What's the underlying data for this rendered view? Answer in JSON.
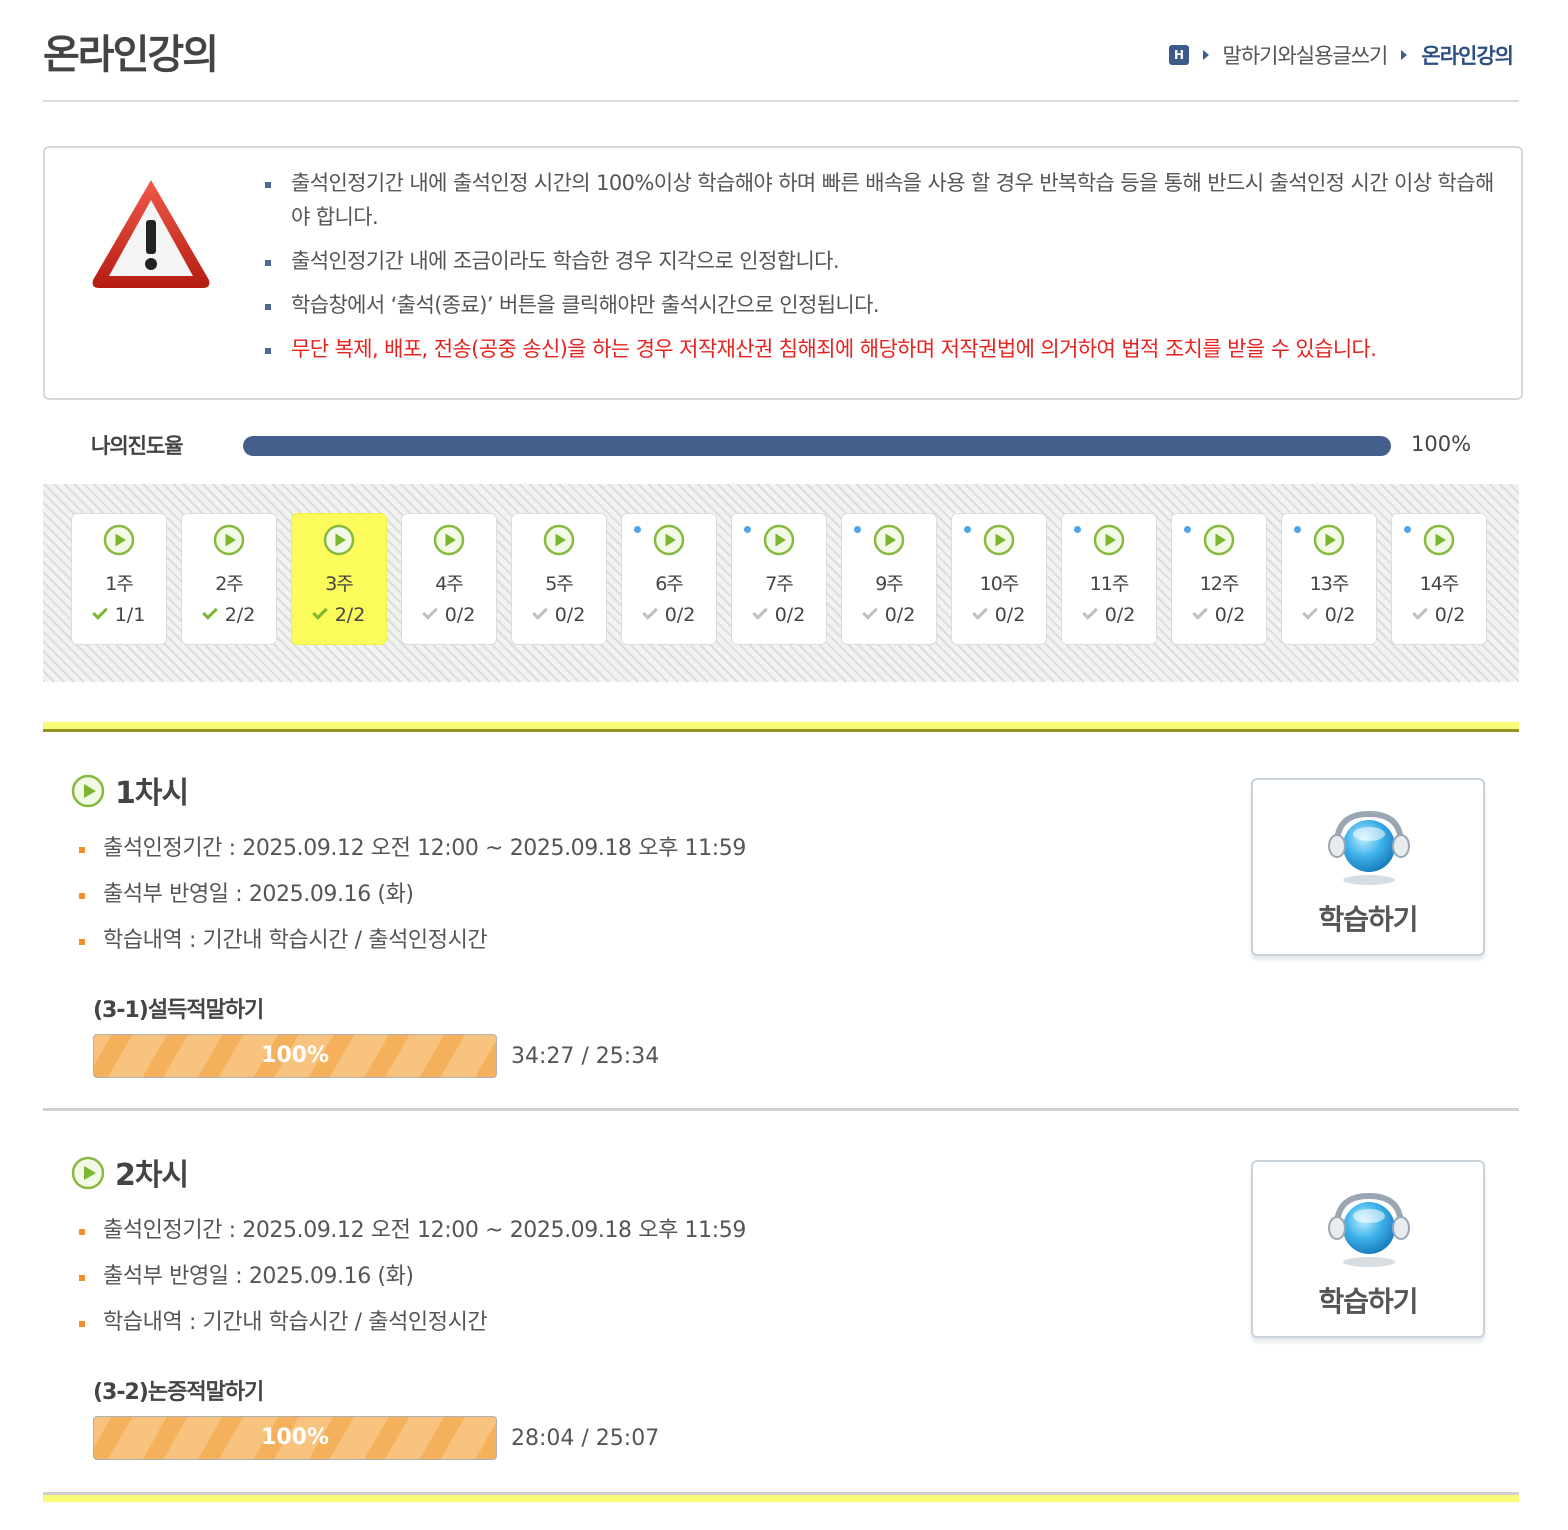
{
  "header": {
    "title": "온라인강의",
    "breadcrumb": {
      "home_icon": "home-icon",
      "home_label": "H",
      "items": [
        "말하기와실용글쓰기",
        "온라인강의"
      ]
    }
  },
  "notice": {
    "icon": "warning-icon",
    "items": [
      {
        "text": "출석인정기간 내에 출석인정 시간의 100%이상 학습해야 하며 빠른 배속을 사용 할 경우 반복학습 등을 통해 반드시 출석인정 시간 이상 학습해야 합니다.",
        "color": "#555555"
      },
      {
        "text": "출석인정기간 내에 조금이라도 학습한 경우 지각으로 인정합니다.",
        "color": "#555555"
      },
      {
        "text": "학습창에서 ‘출석(종료)’ 버튼을 클릭해야만 출석시간으로 인정됩니다.",
        "color": "#555555"
      },
      {
        "text": "무단 복제, 배포, 전송(공중 송신)을 하는 경우 저작재산권 침해죄에 해당하며 저작권법에 의거하여 법적 조치를 받을 수 있습니다.",
        "color": "#e8231f"
      }
    ]
  },
  "progress": {
    "label": "나의진도율",
    "value": "100%",
    "fraction": 1.0,
    "color": "#455f8c"
  },
  "weeks": [
    {
      "label": "1주",
      "count": "1/1",
      "done": true,
      "active": false,
      "dot": false
    },
    {
      "label": "2주",
      "count": "2/2",
      "done": true,
      "active": false,
      "dot": false
    },
    {
      "label": "3주",
      "count": "2/2",
      "done": true,
      "active": true,
      "dot": false
    },
    {
      "label": "4주",
      "count": "0/2",
      "done": false,
      "active": false,
      "dot": false
    },
    {
      "label": "5주",
      "count": "0/2",
      "done": false,
      "active": false,
      "dot": false
    },
    {
      "label": "6주",
      "count": "0/2",
      "done": false,
      "active": false,
      "dot": true
    },
    {
      "label": "7주",
      "count": "0/2",
      "done": false,
      "active": false,
      "dot": true
    },
    {
      "label": "9주",
      "count": "0/2",
      "done": false,
      "active": false,
      "dot": true
    },
    {
      "label": "10주",
      "count": "0/2",
      "done": false,
      "active": false,
      "dot": true
    },
    {
      "label": "11주",
      "count": "0/2",
      "done": false,
      "active": false,
      "dot": true
    },
    {
      "label": "12주",
      "count": "0/2",
      "done": false,
      "active": false,
      "dot": true
    },
    {
      "label": "13주",
      "count": "0/2",
      "done": false,
      "active": false,
      "dot": true
    },
    {
      "label": "14주",
      "count": "0/2",
      "done": false,
      "active": false,
      "dot": true
    }
  ],
  "sessions": [
    {
      "title": "1차시",
      "period": "출석인정기간 : 2025.09.12 오전 12:00 ~ 2025.09.18 오후 11:59",
      "reflect": "출석부 반영일 : 2025.09.16 (화)",
      "history": "학습내역 : 기간내 학습시간 / 출석인정시간",
      "lesson": "(3-1)설득적말하기",
      "percent": "100%",
      "time": "34:27 / 25:34",
      "button": "학습하기"
    },
    {
      "title": "2차시",
      "period": "출석인정기간 : 2025.09.12 오전 12:00 ~ 2025.09.18 오후 11:59",
      "reflect": "출석부 반영일 : 2025.09.16 (화)",
      "history": "학습내역 : 기간내 학습시간 / 출석인정시간",
      "lesson": "(3-2)논증적말하기",
      "percent": "100%",
      "time": "28:04 / 25:07",
      "button": "학습하기"
    }
  ],
  "colors": {
    "accent": "#455f8c",
    "warning": "#e8231f",
    "active_week": "#fbfb5c",
    "check_done": "#7cb631",
    "bullet_orange": "#f0902c"
  }
}
